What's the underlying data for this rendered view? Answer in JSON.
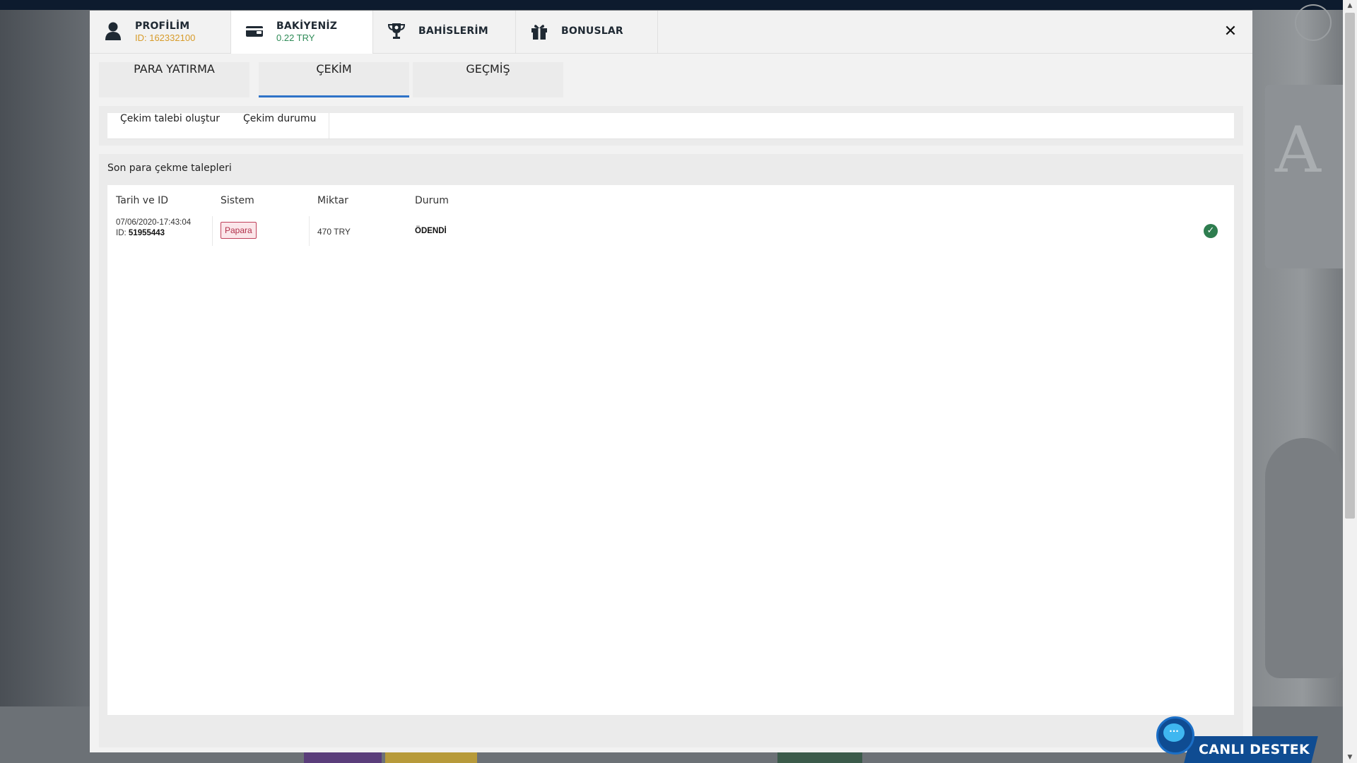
{
  "header": {
    "tabs": [
      {
        "title": "PROFİLİM",
        "subtitle": "ID: 162332100",
        "icon": "user-icon",
        "subtitle_color": "#d79b2a"
      },
      {
        "title": "BAKİYENİZ",
        "subtitle": "0.22 TRY",
        "icon": "wallet-icon",
        "subtitle_color": "#2e8b57"
      },
      {
        "title": "BAHİSLERİM",
        "icon": "trophy-icon"
      },
      {
        "title": "BONUSLAR",
        "icon": "gift-icon"
      }
    ],
    "close_label": "✕"
  },
  "main_tabs": [
    "PARA YATIRMA",
    "ÇEKİM",
    "GEÇMİŞ"
  ],
  "sub_tabs": [
    "Çekim talebi oluştur",
    "Çekim durumu"
  ],
  "panel": {
    "title": "Son para çekme talepleri",
    "columns": [
      "Tarih ve ID",
      "Sistem",
      "Miktar",
      "Durum"
    ],
    "rows": [
      {
        "date": "07/06/2020-17:43:04",
        "id_label": "ID:",
        "id": "51955443",
        "system": "Papara",
        "amount": "470 TRY",
        "status": "ÖDENDİ"
      }
    ]
  },
  "live_support": {
    "label": "CANLI DESTEK"
  },
  "colors": {
    "accent": "#2f73c8",
    "badge_border": "#c0405a",
    "success": "#2e7d4f"
  }
}
